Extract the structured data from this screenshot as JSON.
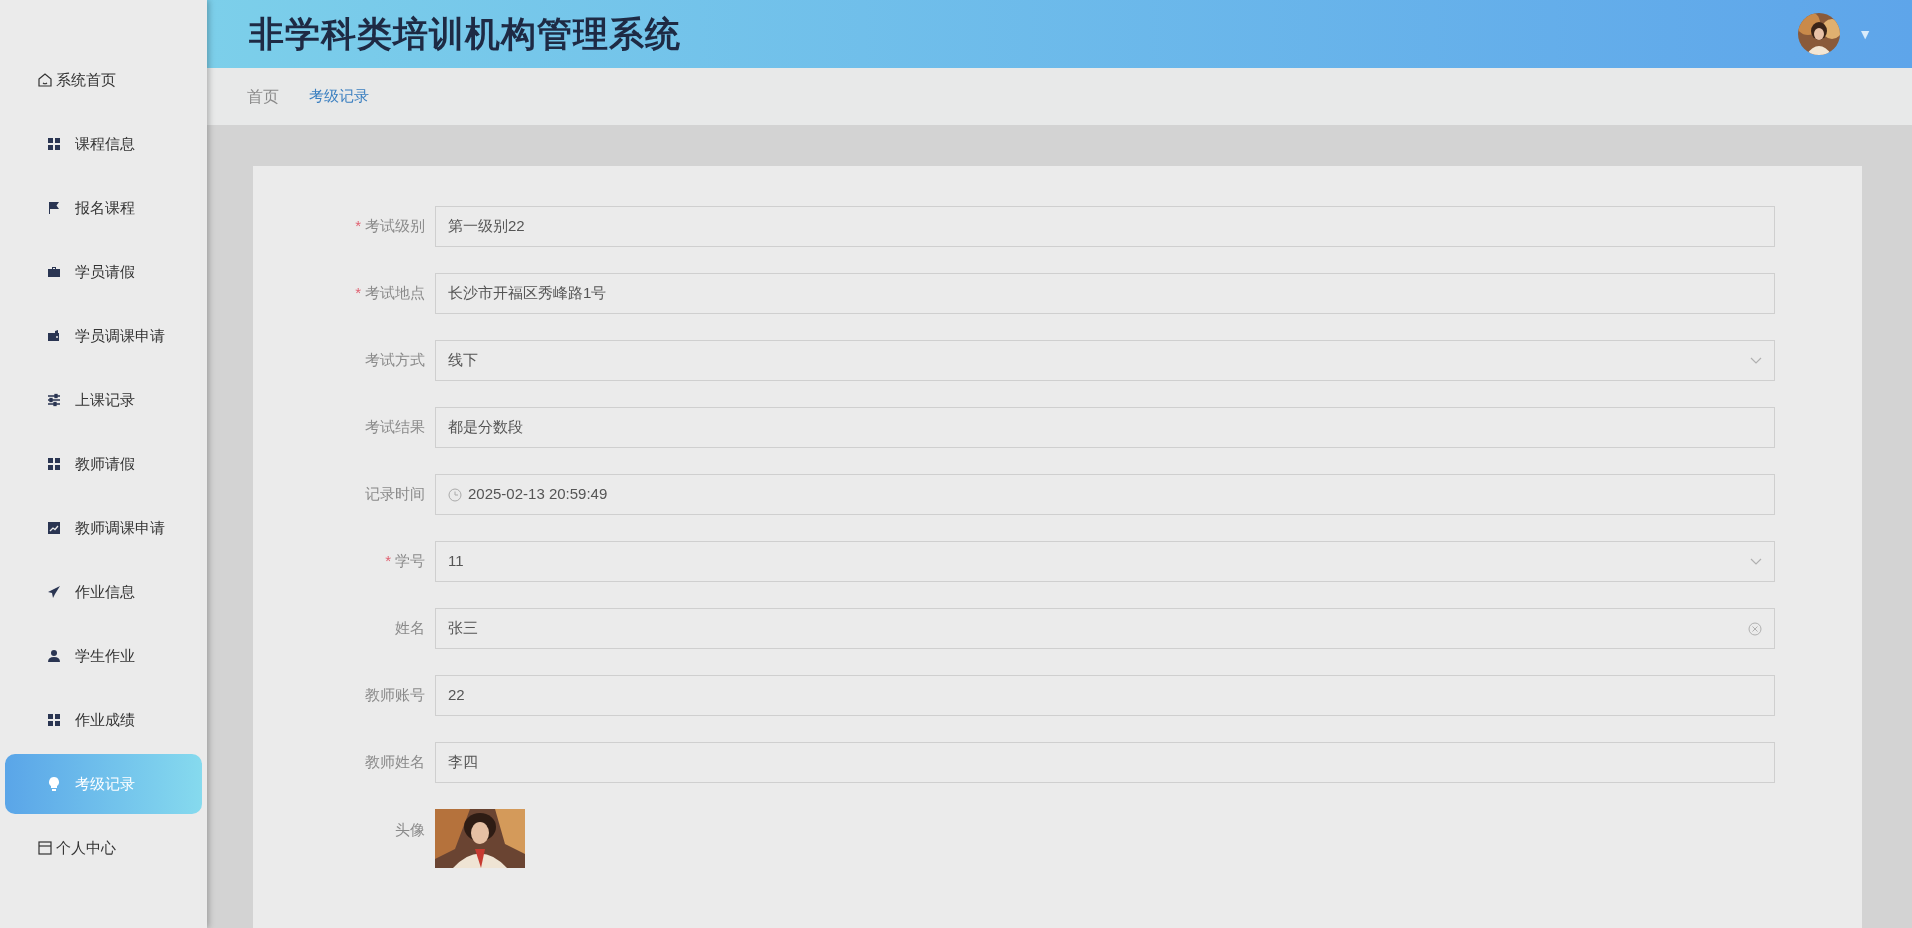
{
  "header": {
    "title": "非学科类培训机构管理系统",
    "menu_caret": "▼"
  },
  "breadcrumb": [
    {
      "label": "首页",
      "selected": false
    },
    {
      "label": "考级记录",
      "selected": true
    }
  ],
  "sidebar": {
    "items": [
      {
        "label": "系统首页",
        "selected": false
      },
      {
        "label": "课程信息",
        "selected": false
      },
      {
        "label": "报名课程",
        "selected": false
      },
      {
        "label": "学员请假",
        "selected": false
      },
      {
        "label": "学员调课申请",
        "selected": false
      },
      {
        "label": "上课记录",
        "selected": false
      },
      {
        "label": "教师请假",
        "selected": false
      },
      {
        "label": "教师调课申请",
        "selected": false
      },
      {
        "label": "作业信息",
        "selected": false
      },
      {
        "label": "学生作业",
        "selected": false
      },
      {
        "label": "作业成绩",
        "selected": false
      },
      {
        "label": "考级记录",
        "selected": true
      },
      {
        "label": "个人中心",
        "selected": false
      }
    ]
  },
  "form": {
    "fields": [
      {
        "label": "考试级别",
        "required_mark": "*",
        "kind": "text",
        "value": "第一级别22"
      },
      {
        "label": "考试地点",
        "required_mark": "*",
        "kind": "text",
        "value": "长沙市开福区秀峰路1号"
      },
      {
        "label": "考试方式",
        "kind": "select",
        "value": "线下"
      },
      {
        "label": "考试结果",
        "kind": "text",
        "value": "都是分数段"
      },
      {
        "label": "记录时间",
        "kind": "date",
        "value": "2025-02-13 20:59:49"
      },
      {
        "label": "学号",
        "required_mark": "*",
        "kind": "select",
        "value": "11"
      },
      {
        "label": "姓名",
        "kind": "clearable",
        "value": "张三"
      },
      {
        "label": "教师账号",
        "kind": "text",
        "value": "22"
      },
      {
        "label": "教师姓名",
        "kind": "text",
        "value": "李四"
      },
      {
        "label": "头像"
      }
    ]
  }
}
